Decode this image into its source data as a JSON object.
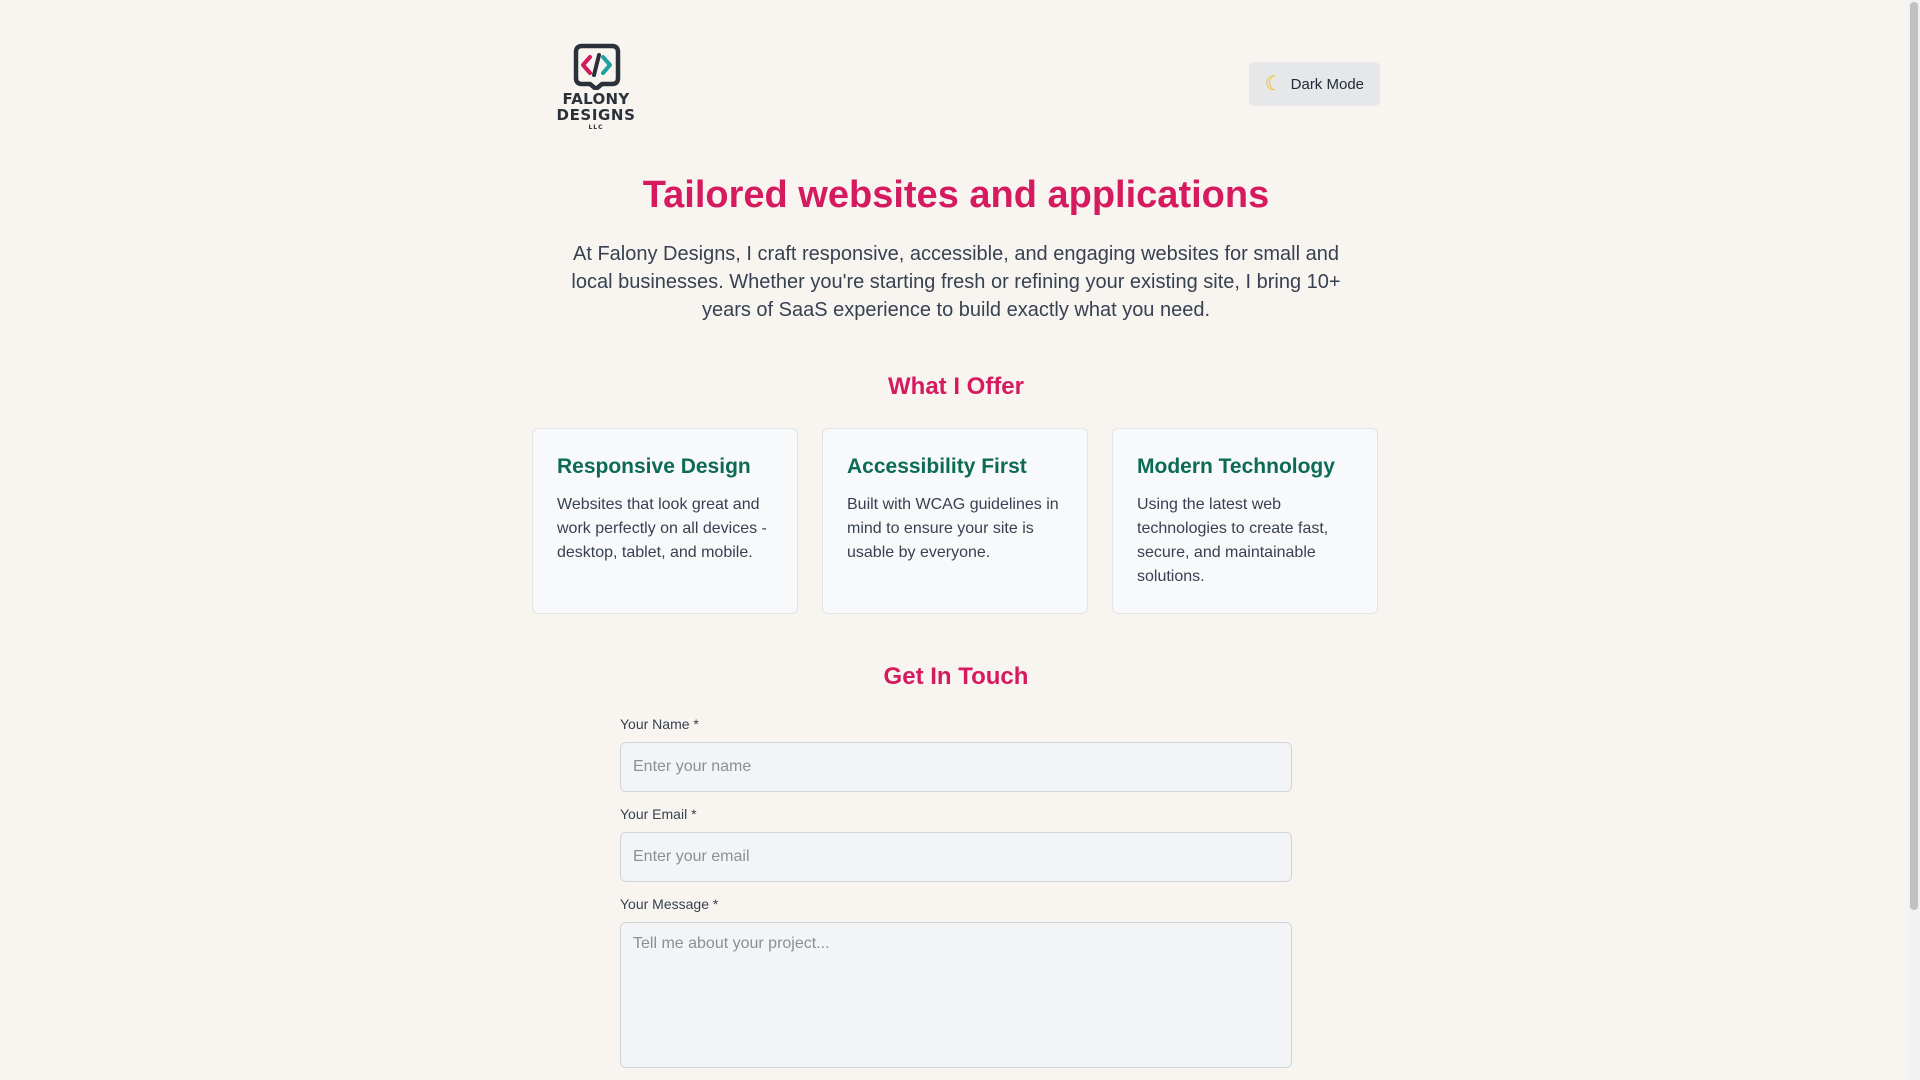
{
  "header": {
    "logo": {
      "line1": "FALONY",
      "line2": "DESIGNS",
      "line3": "LLC",
      "icon": "code-bracket-icon",
      "colors": {
        "dark": "#2a3138",
        "pink": "#d51a60",
        "teal": "#1fa2a0"
      }
    },
    "dark_mode_button": {
      "icon": "moon-icon",
      "label": "Dark Mode"
    }
  },
  "hero": {
    "title": "Tailored websites and applications",
    "text": "At Falony Designs, I craft responsive, accessible, and engaging websites for small and local businesses. Whether you're starting fresh or refining your existing site, I bring 10+ years of SaaS experience to build exactly what you need."
  },
  "offer": {
    "title": "What I Offer",
    "cards": [
      {
        "title": "Responsive Design",
        "text": "Websites that look great and work perfectly on all devices - desktop, tablet, and mobile."
      },
      {
        "title": "Accessibility First",
        "text": "Built with WCAG guidelines in mind to ensure your site is usable by everyone."
      },
      {
        "title": "Modern Technology",
        "text": "Using the latest web technologies to create fast, secure, and maintainable solutions."
      }
    ]
  },
  "contact": {
    "title": "Get In Touch",
    "fields": {
      "name": {
        "label": "Your Name *",
        "placeholder": "Enter your name",
        "value": ""
      },
      "email": {
        "label": "Your Email *",
        "placeholder": "Enter your email",
        "value": ""
      },
      "message": {
        "label": "Your Message *",
        "placeholder": "Tell me about your project...",
        "value": ""
      }
    }
  },
  "colors": {
    "accent": "#d51a60",
    "card_heading": "#0d6b55",
    "background": "#f8f5f0"
  }
}
